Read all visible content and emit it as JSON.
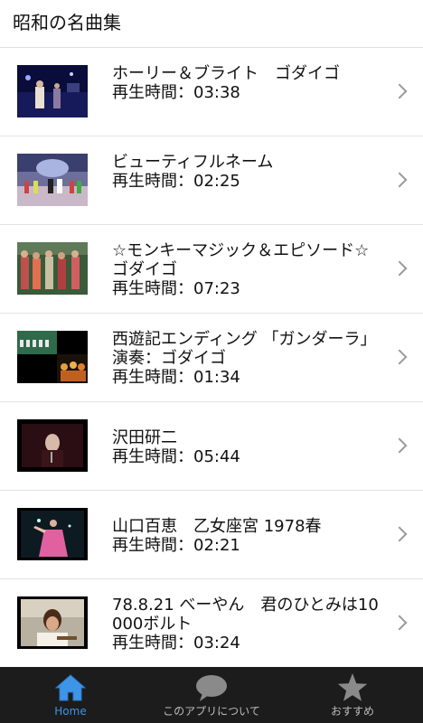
{
  "header": {
    "title": "昭和の名曲集"
  },
  "duration_prefix": "再生時間：",
  "songs": [
    {
      "title": "ホーリー＆ブライト　ゴダイゴ",
      "duration": "再生時間：03:38",
      "thumb": "thumb-1"
    },
    {
      "title": "ビューティフルネーム",
      "duration": "再生時間：02:25",
      "thumb": "thumb-2"
    },
    {
      "title": "☆モンキーマジック＆エピソード☆　ゴダイゴ",
      "duration": "再生時間：07:23",
      "thumb": "thumb-3"
    },
    {
      "title": "西遊記エンディング 「ガンダーラ」 演奏：ゴダイゴ",
      "duration": "再生時間：01:34",
      "thumb": "thumb-4"
    },
    {
      "title": "沢田研二",
      "duration": "再生時間：05:44",
      "thumb": "thumb-5"
    },
    {
      "title": "山口百恵　乙女座宮 1978春",
      "duration": "再生時間：02:21",
      "thumb": "thumb-6"
    },
    {
      "title": "78.8.21 べーやん　君のひとみは10000ボルト",
      "duration": "再生時間：03:24",
      "thumb": "thumb-7"
    }
  ],
  "tabbar": {
    "items": [
      {
        "label": "Home",
        "icon": "home-icon",
        "active": true
      },
      {
        "label": "このアプリについて",
        "icon": "speech-bubble-icon",
        "active": false
      },
      {
        "label": "おすすめ",
        "icon": "star-icon",
        "active": false
      }
    ]
  },
  "colors": {
    "accent": "#3d95e8",
    "tabbar_bg": "#1c1c1c",
    "tab_inactive": "#bdbdbd"
  }
}
